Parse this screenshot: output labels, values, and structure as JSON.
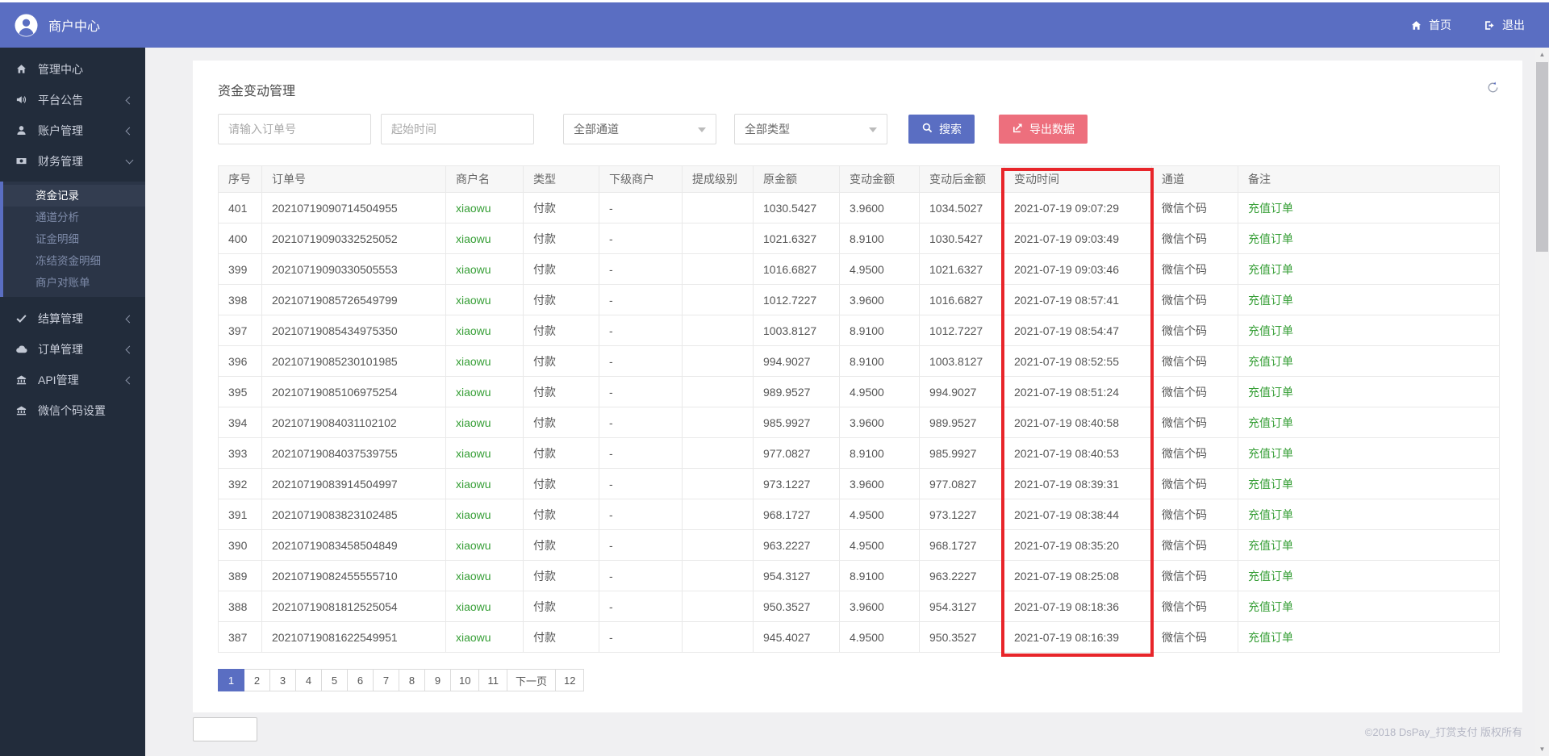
{
  "topbar": {
    "brand": "商户中心",
    "links": [
      {
        "key": "home",
        "label": "首页",
        "icon": "home"
      },
      {
        "key": "logout",
        "label": "退出",
        "icon": "logout"
      }
    ]
  },
  "sidebar": {
    "items": [
      {
        "key": "admin-center",
        "label": "管理中心",
        "icon": "home"
      },
      {
        "key": "platform-announce",
        "label": "平台公告",
        "icon": "speaker",
        "chevron": "left"
      },
      {
        "key": "account-management",
        "label": "账户管理",
        "icon": "user",
        "chevron": "left"
      },
      {
        "key": "finance-management",
        "label": "财务管理",
        "icon": "money",
        "chevron": "down",
        "expanded": true,
        "children": [
          {
            "key": "fund-records",
            "label": "资金记录",
            "active": true
          },
          {
            "key": "channel-analysis",
            "label": "通道分析"
          },
          {
            "key": "deposit-details",
            "label": "证金明细"
          },
          {
            "key": "frozen-fund-details",
            "label": "冻结资金明细"
          },
          {
            "key": "merchant-statement",
            "label": "商户对账单"
          }
        ]
      },
      {
        "key": "settlement-management",
        "label": "结算管理",
        "icon": "check",
        "chevron": "left"
      },
      {
        "key": "order-management",
        "label": "订单管理",
        "icon": "cloud",
        "chevron": "left"
      },
      {
        "key": "api-management",
        "label": "API管理",
        "icon": "bank",
        "chevron": "left"
      },
      {
        "key": "wechat-code-settings",
        "label": "微信个码设置",
        "icon": "bank"
      }
    ]
  },
  "page": {
    "title": "资金变动管理",
    "filters": {
      "order_input_placeholder": "请输入订单号",
      "time_input_placeholder": "起始时间",
      "channel_select_value": "全部通道",
      "type_select_value": "全部类型",
      "search_button": "搜索",
      "export_button": "导出数据"
    },
    "table": {
      "headers": [
        "序号",
        "订单号",
        "商户名",
        "类型",
        "下级商户",
        "提成级别",
        "原金额",
        "变动金额",
        "变动后金额",
        "变动时间",
        "通道",
        "备注"
      ],
      "highlighted_column": "变动时间",
      "rows": [
        [
          "401",
          "20210719090714504955",
          "xiaowu",
          "付款",
          "-",
          "",
          "1030.5427",
          "3.9600",
          "1034.5027",
          "2021-07-19 09:07:29",
          "微信个码",
          "充值订单"
        ],
        [
          "400",
          "20210719090332525052",
          "xiaowu",
          "付款",
          "-",
          "",
          "1021.6327",
          "8.9100",
          "1030.5427",
          "2021-07-19 09:03:49",
          "微信个码",
          "充值订单"
        ],
        [
          "399",
          "20210719090330505553",
          "xiaowu",
          "付款",
          "-",
          "",
          "1016.6827",
          "4.9500",
          "1021.6327",
          "2021-07-19 09:03:46",
          "微信个码",
          "充值订单"
        ],
        [
          "398",
          "20210719085726549799",
          "xiaowu",
          "付款",
          "-",
          "",
          "1012.7227",
          "3.9600",
          "1016.6827",
          "2021-07-19 08:57:41",
          "微信个码",
          "充值订单"
        ],
        [
          "397",
          "20210719085434975350",
          "xiaowu",
          "付款",
          "-",
          "",
          "1003.8127",
          "8.9100",
          "1012.7227",
          "2021-07-19 08:54:47",
          "微信个码",
          "充值订单"
        ],
        [
          "396",
          "20210719085230101985",
          "xiaowu",
          "付款",
          "-",
          "",
          "994.9027",
          "8.9100",
          "1003.8127",
          "2021-07-19 08:52:55",
          "微信个码",
          "充值订单"
        ],
        [
          "395",
          "20210719085106975254",
          "xiaowu",
          "付款",
          "-",
          "",
          "989.9527",
          "4.9500",
          "994.9027",
          "2021-07-19 08:51:24",
          "微信个码",
          "充值订单"
        ],
        [
          "394",
          "20210719084031102102",
          "xiaowu",
          "付款",
          "-",
          "",
          "985.9927",
          "3.9600",
          "989.9527",
          "2021-07-19 08:40:58",
          "微信个码",
          "充值订单"
        ],
        [
          "393",
          "20210719084037539755",
          "xiaowu",
          "付款",
          "-",
          "",
          "977.0827",
          "8.9100",
          "985.9927",
          "2021-07-19 08:40:53",
          "微信个码",
          "充值订单"
        ],
        [
          "392",
          "20210719083914504997",
          "xiaowu",
          "付款",
          "-",
          "",
          "973.1227",
          "3.9600",
          "977.0827",
          "2021-07-19 08:39:31",
          "微信个码",
          "充值订单"
        ],
        [
          "391",
          "20210719083823102485",
          "xiaowu",
          "付款",
          "-",
          "",
          "968.1727",
          "4.9500",
          "973.1227",
          "2021-07-19 08:38:44",
          "微信个码",
          "充值订单"
        ],
        [
          "390",
          "20210719083458504849",
          "xiaowu",
          "付款",
          "-",
          "",
          "963.2227",
          "4.9500",
          "968.1727",
          "2021-07-19 08:35:20",
          "微信个码",
          "充值订单"
        ],
        [
          "389",
          "20210719082455555710",
          "xiaowu",
          "付款",
          "-",
          "",
          "954.3127",
          "8.9100",
          "963.2227",
          "2021-07-19 08:25:08",
          "微信个码",
          "充值订单"
        ],
        [
          "388",
          "20210719081812525054",
          "xiaowu",
          "付款",
          "-",
          "",
          "950.3527",
          "3.9600",
          "954.3127",
          "2021-07-19 08:18:36",
          "微信个码",
          "充值订单"
        ],
        [
          "387",
          "20210719081622549951",
          "xiaowu",
          "付款",
          "-",
          "",
          "945.4027",
          "4.9500",
          "950.3527",
          "2021-07-19 08:16:39",
          "微信个码",
          "充值订单"
        ]
      ]
    },
    "pagination": {
      "pages": [
        {
          "label": "1",
          "active": true
        },
        {
          "label": "2"
        },
        {
          "label": "3"
        },
        {
          "label": "4"
        },
        {
          "label": "5"
        },
        {
          "label": "6"
        },
        {
          "label": "7"
        },
        {
          "label": "8"
        },
        {
          "label": "9"
        },
        {
          "label": "10"
        },
        {
          "label": "11"
        },
        {
          "label": "下一页"
        },
        {
          "label": "12"
        }
      ]
    },
    "footer": "©2018 DsPay_打赏支付 版权所有"
  },
  "colors": {
    "accent": "#5A6EC2",
    "danger": "#ED6F7D",
    "green": "#359E35",
    "highlight_red": "#E8252A",
    "sidebar_bg": "#222C3B",
    "submenu_bg": "#2B3547",
    "submenu_active_bg": "#333D50",
    "page_bg": "#F0F0F2"
  }
}
